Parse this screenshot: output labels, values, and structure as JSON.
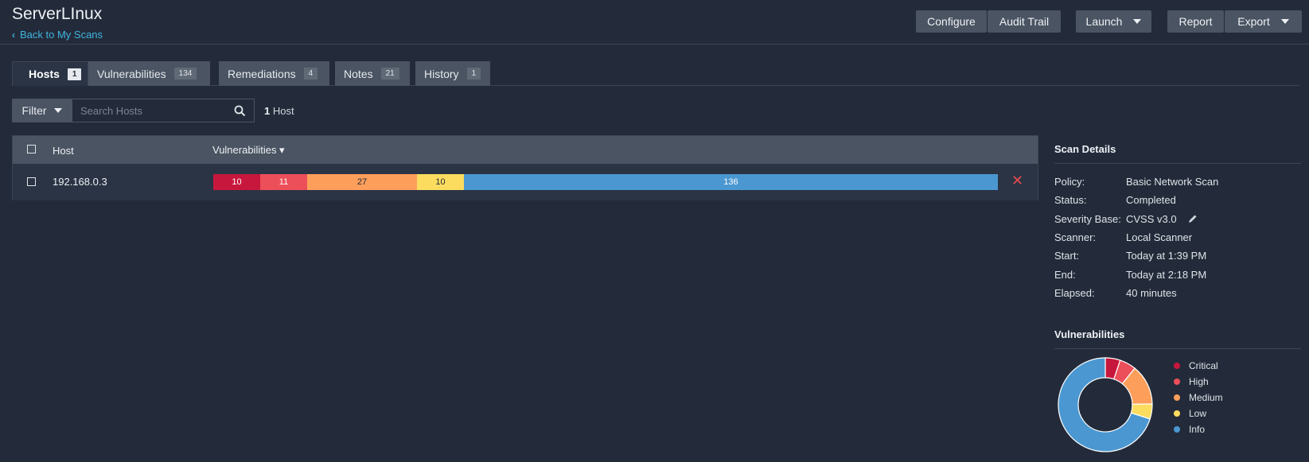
{
  "header": {
    "title": "ServerLInux",
    "back_link": "Back to My Scans",
    "buttons": {
      "configure": "Configure",
      "audit_trail": "Audit Trail",
      "launch": "Launch",
      "report": "Report",
      "export": "Export"
    }
  },
  "tabs": [
    {
      "label": "Hosts",
      "count": "1",
      "active": true
    },
    {
      "label": "Vulnerabilities",
      "count": "134"
    },
    {
      "label": "Remediations",
      "count": "4"
    },
    {
      "label": "Notes",
      "count": "21"
    },
    {
      "label": "History",
      "count": "1"
    }
  ],
  "filter": {
    "label": "Filter",
    "search_placeholder": "Search Hosts",
    "host_count": "1",
    "host_count_suffix": "Host"
  },
  "table": {
    "columns": {
      "host": "Host",
      "vulnerabilities": "Vulnerabilities ▾"
    },
    "rows": [
      {
        "host": "192.168.0.3",
        "vulns": [
          {
            "severity": "Critical",
            "count": "10",
            "color": "#c8173c"
          },
          {
            "severity": "High",
            "count": "11",
            "color": "#ec4f59"
          },
          {
            "severity": "Medium",
            "count": "27",
            "color": "#fd9f5a"
          },
          {
            "severity": "Low",
            "count": "10",
            "color": "#fcdc5e"
          },
          {
            "severity": "Info",
            "count": "136",
            "color": "#4a97d1"
          }
        ]
      }
    ]
  },
  "scan_details": {
    "heading": "Scan Details",
    "items": [
      {
        "label": "Policy:",
        "value": "Basic Network Scan"
      },
      {
        "label": "Status:",
        "value": "Completed"
      },
      {
        "label": "Severity Base:",
        "value": "CVSS v3.0"
      },
      {
        "label": "Scanner:",
        "value": "Local Scanner"
      },
      {
        "label": "Start:",
        "value": "Today at 1:39 PM"
      },
      {
        "label": "End:",
        "value": "Today at 2:18 PM"
      },
      {
        "label": "Elapsed:",
        "value": "40 minutes"
      }
    ]
  },
  "vuln_chart": {
    "heading": "Vulnerabilities",
    "legend": [
      {
        "label": "Critical",
        "color": "#c8173c"
      },
      {
        "label": "High",
        "color": "#ec4f59"
      },
      {
        "label": "Medium",
        "color": "#fd9f5a"
      },
      {
        "label": "Low",
        "color": "#fcdc5e"
      },
      {
        "label": "Info",
        "color": "#4a97d1"
      }
    ]
  },
  "chart_data": {
    "type": "pie",
    "categories": [
      "Critical",
      "High",
      "Medium",
      "Low",
      "Info"
    ],
    "values": [
      10,
      11,
      27,
      10,
      136
    ],
    "colors": [
      "#c8173c",
      "#ec4f59",
      "#fd9f5a",
      "#fcdc5e",
      "#4a97d1"
    ],
    "title": "Vulnerabilities",
    "legend_position": "right",
    "donut": true
  }
}
